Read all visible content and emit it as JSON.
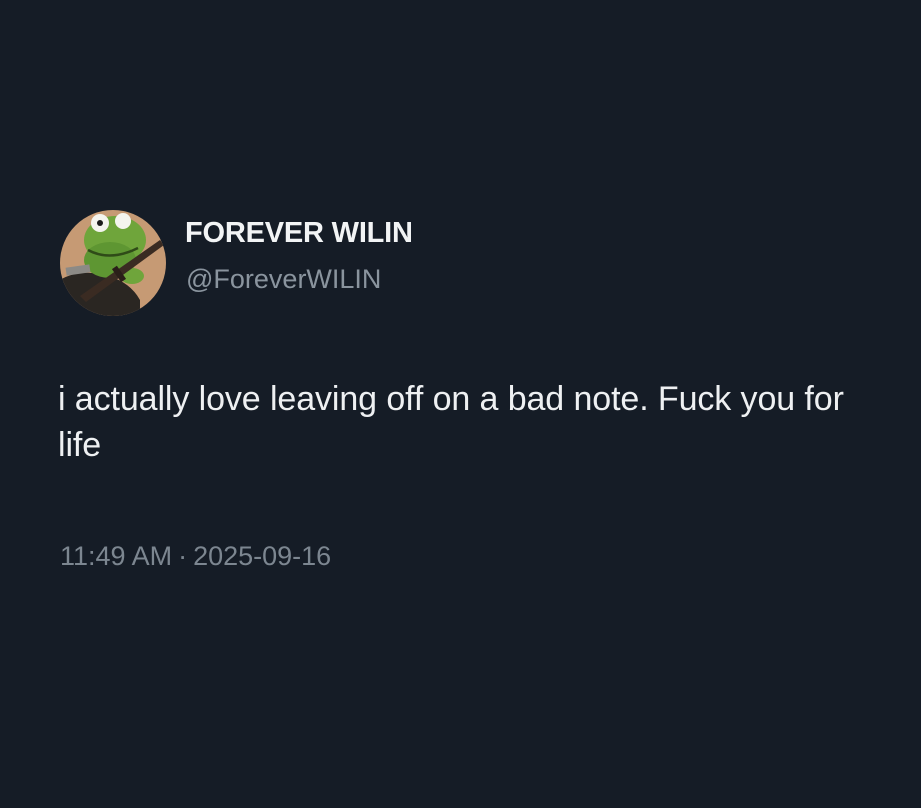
{
  "colors": {
    "background": "#151c26",
    "primary_text": "#eef0f2",
    "secondary_text": "#8a949e"
  },
  "author": {
    "display_name": "FOREVER WILIN",
    "handle": "@ForeverWILIN",
    "avatar_icon": "frog-avatar-icon"
  },
  "tweet": {
    "text": "i actually love leaving off on a bad note. Fuck you for life",
    "time": "11:49 AM",
    "separator": "·",
    "date": "2025-09-16"
  }
}
